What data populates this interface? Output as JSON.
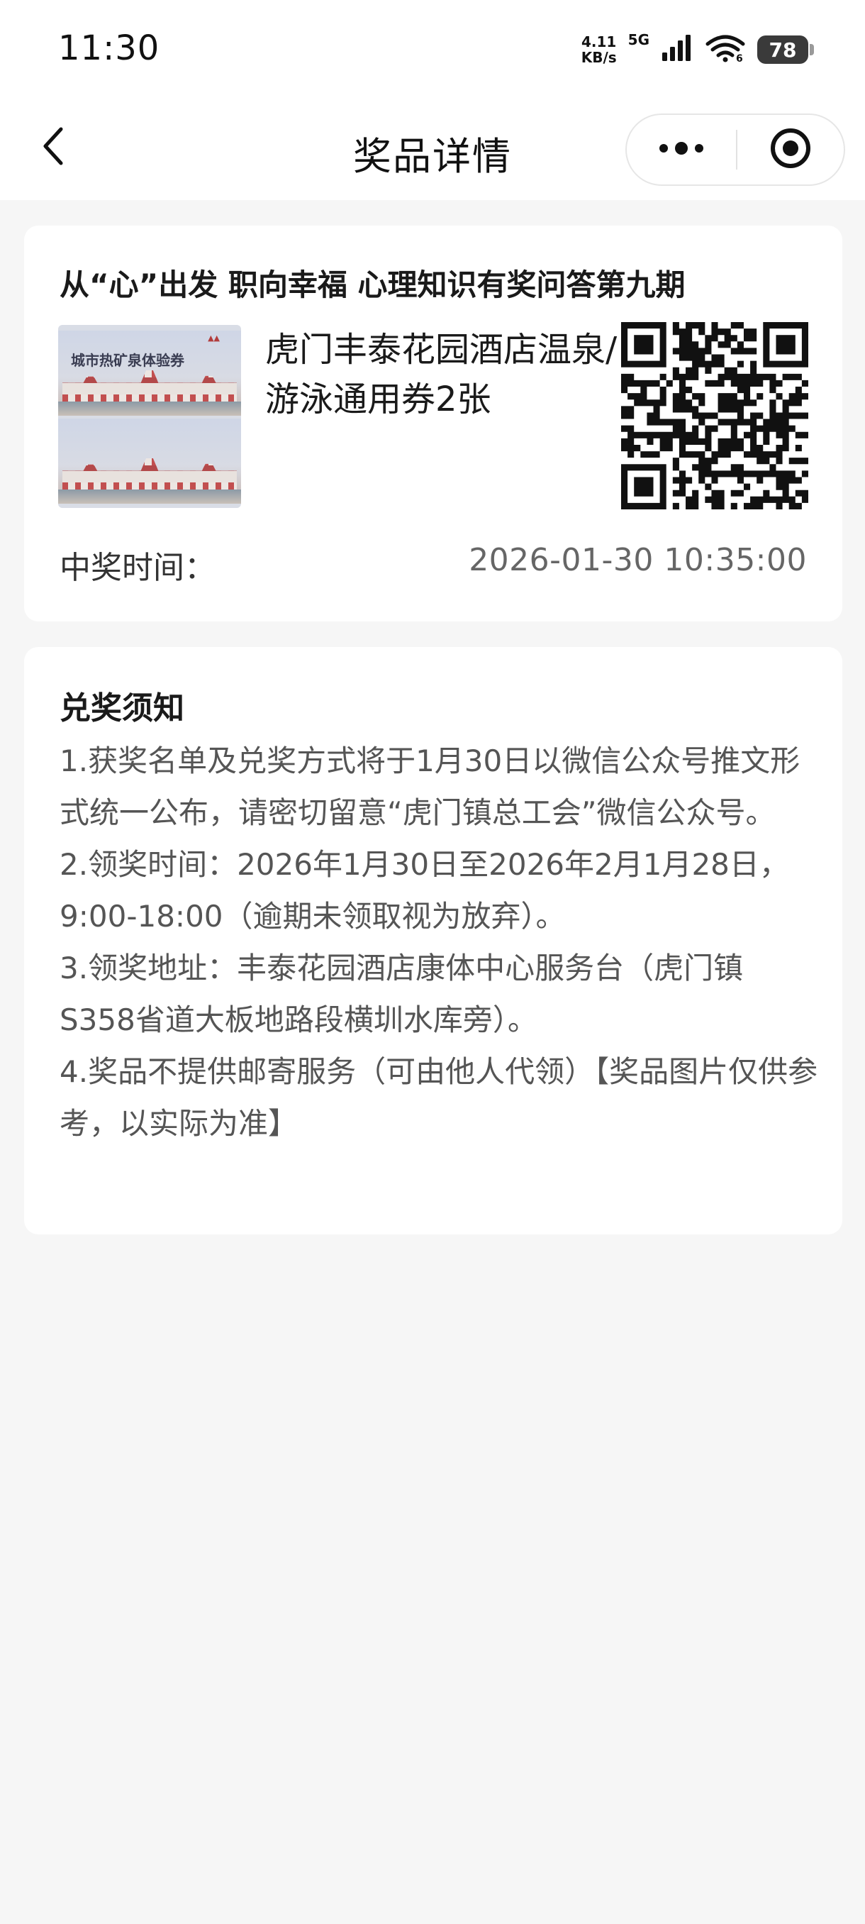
{
  "status_bar": {
    "time": "11:30",
    "net_speed_value": "4.11",
    "net_speed_unit": "KB/s",
    "network": "5G",
    "battery": "78",
    "icons": [
      "signal-bars-icon",
      "wifi-icon",
      "battery-icon"
    ]
  },
  "nav": {
    "title": "奖品详情",
    "icons": [
      "back-chevron-icon",
      "more-dots-icon",
      "close-target-icon"
    ]
  },
  "prize": {
    "activity_title": "从“心”出发 职向幸福 心理知识有奖问答第九期",
    "image_text": "城市热矿泉体验券",
    "name": "虎门丰泰花园酒店温泉/游泳通用券2张",
    "win_time_label": "中奖时间：",
    "win_time_value": "2026-01-30 10:35:00"
  },
  "notice": {
    "title": "兑奖须知",
    "items": [
      "1.获奖名单及兑奖方式将于1月30日以微信公众号推文形式统一公布，请密切留意“虎门镇总工会”微信公众号。",
      "2.领奖时间：2026年1月30日至2026年2月1月28日，9:00-18:00（逾期未领取视为放弃）。",
      "3.领奖地址：丰泰花园酒店康体中心服务台（虎门镇S358省道大板地路段横圳水库旁）。",
      "4.奖品不提供邮寄服务（可由他人代领）【奖品图片仅供参考，以实际为准】"
    ]
  },
  "colors": {
    "page_background": "#f6f6f6",
    "card_background": "#ffffff",
    "primary_text": "#1a1a1a",
    "secondary_text": "#666666"
  }
}
